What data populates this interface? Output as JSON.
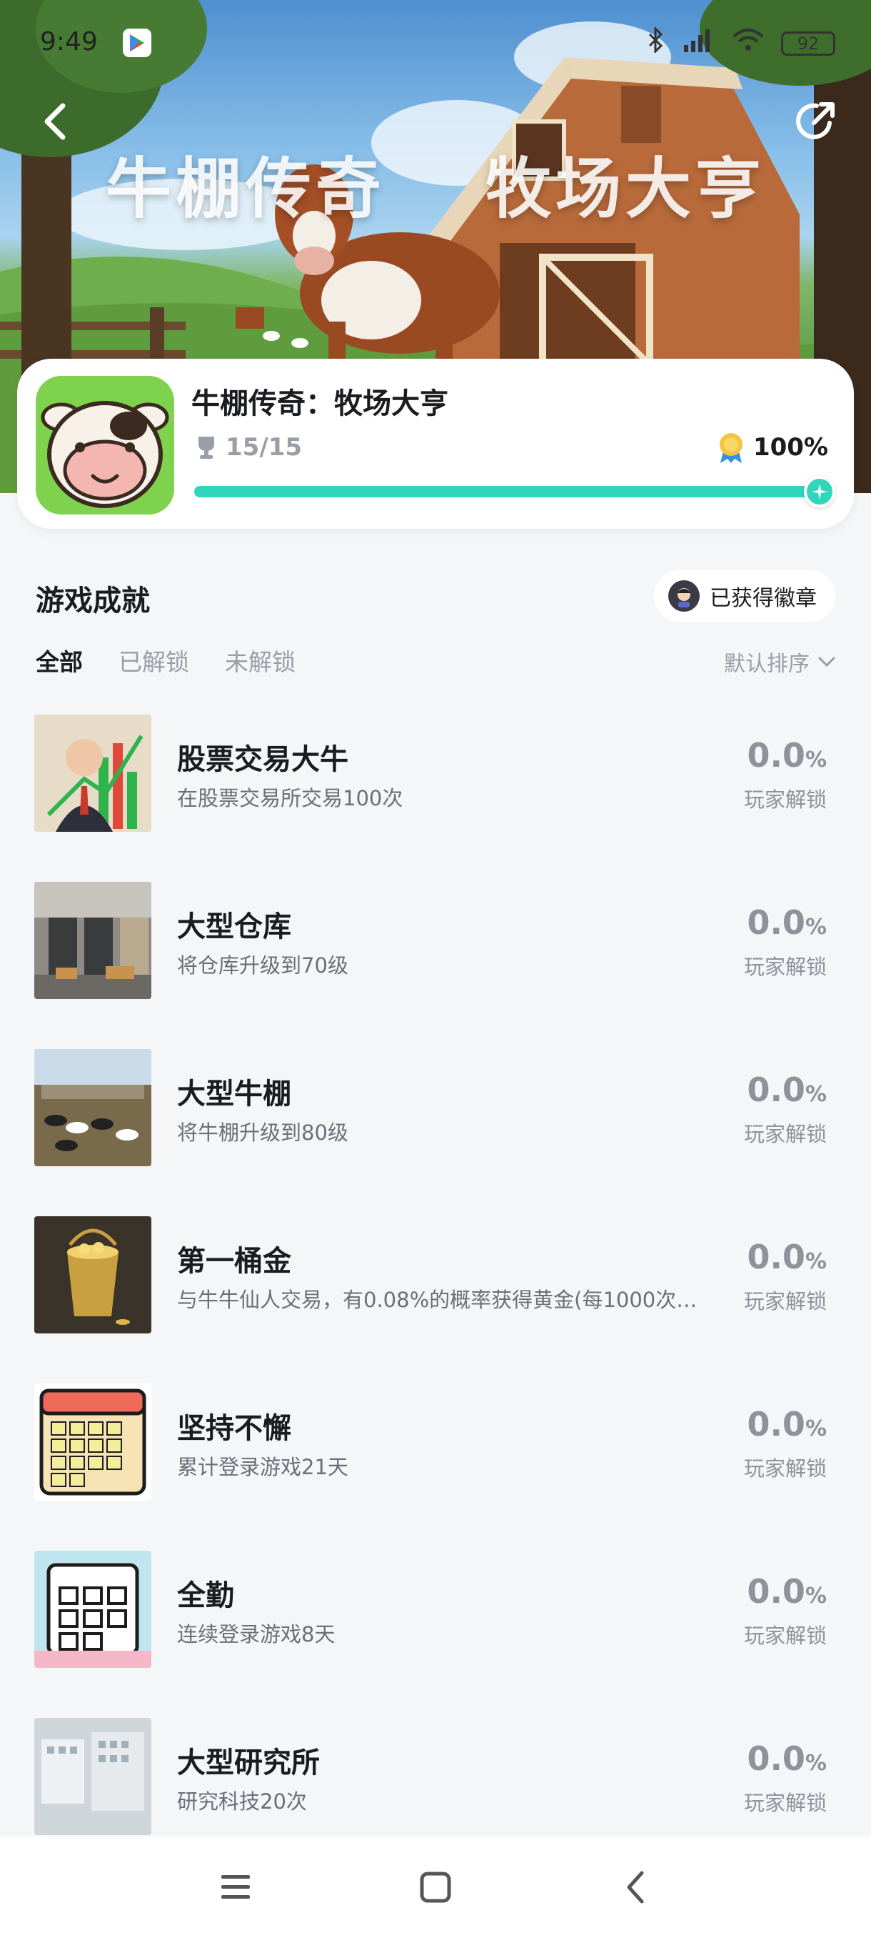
{
  "status_bar": {
    "time": "9:49",
    "battery": "92"
  },
  "hero": {
    "title_left": "牛棚传奇",
    "title_right": "牧场大亨"
  },
  "game": {
    "name": "牛棚传奇：牧场大亨",
    "trophy_count": "15/15",
    "completion": "100%",
    "progress": 1.0,
    "accent": "#2fd6bc"
  },
  "section": {
    "title": "游戏成就",
    "badge_button": "已获得徽章",
    "tabs": [
      "全部",
      "已解锁",
      "未解锁"
    ],
    "active_tab": 0,
    "sort_label": "默认排序"
  },
  "achievements": [
    {
      "title": "股票交易大牛",
      "desc": "在股票交易所交易100次",
      "rate": "0.0",
      "unit": "%",
      "unlock_label": "玩家解锁",
      "icon": "stock-trader-thumbnail"
    },
    {
      "title": "大型仓库",
      "desc": "将仓库升级到70级",
      "rate": "0.0",
      "unit": "%",
      "unlock_label": "玩家解锁",
      "icon": "warehouse-thumbnail"
    },
    {
      "title": "大型牛棚",
      "desc": "将牛棚升级到80级",
      "rate": "0.0",
      "unit": "%",
      "unlock_label": "玩家解锁",
      "icon": "cow-barn-thumbnail"
    },
    {
      "title": "第一桶金",
      "desc": "与牛牛仙人交易，有0.08%的概率获得黄金(每1000次…",
      "rate": "0.0",
      "unit": "%",
      "unlock_label": "玩家解锁",
      "icon": "gold-bucket-thumbnail"
    },
    {
      "title": "坚持不懈",
      "desc": "累计登录游戏21天",
      "rate": "0.0",
      "unit": "%",
      "unlock_label": "玩家解锁",
      "icon": "calendar-thumbnail"
    },
    {
      "title": "全勤",
      "desc": "连续登录游戏8天",
      "rate": "0.0",
      "unit": "%",
      "unlock_label": "玩家解锁",
      "icon": "checklist-calendar-thumbnail"
    },
    {
      "title": "大型研究所",
      "desc": "研究科技20次",
      "rate": "0.0",
      "unit": "%",
      "unlock_label": "玩家解锁",
      "icon": "research-institute-thumbnail"
    }
  ]
}
